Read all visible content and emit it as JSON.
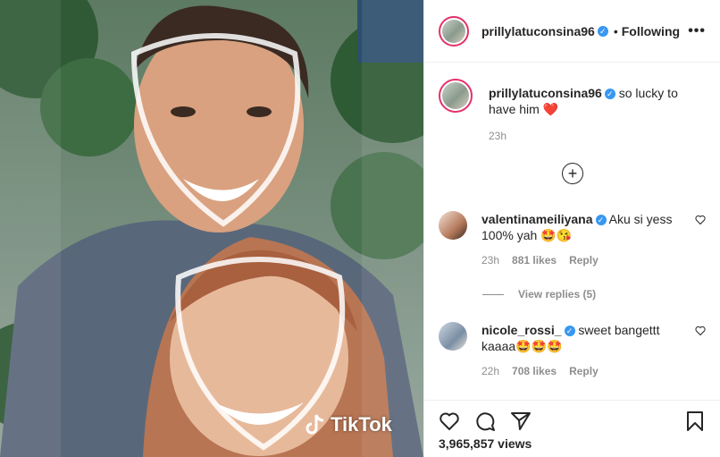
{
  "media": {
    "watermark": "TikTok"
  },
  "post": {
    "author": "prillylatuconsina96",
    "following_label": "Following",
    "dot": "•",
    "more": "•••",
    "caption": "so lucky to have him",
    "caption_emoji": "❤️",
    "time": "23h",
    "add_icon": "+",
    "views": "3,965,857 views"
  },
  "comments": [
    {
      "user": "valentinameiliyana",
      "text": "Aku si yess 100% yah 🤩😘",
      "time": "23h",
      "likes": "881 likes",
      "reply": "Reply",
      "view_replies": "View replies (5)"
    },
    {
      "user": "nicole_rossi_",
      "text": "sweet bangettt kaaaa🤩🤩🤩",
      "time": "22h",
      "likes": "708 likes",
      "reply": "Reply"
    }
  ],
  "icons": {
    "like": "heart-icon",
    "comment": "comment-icon",
    "share": "share-icon",
    "save": "bookmark-icon",
    "verified": "verified-badge-icon"
  },
  "colors": {
    "verified": "#3897f0",
    "secondary_text": "#8e8e8e",
    "heart": "#ed4956"
  }
}
